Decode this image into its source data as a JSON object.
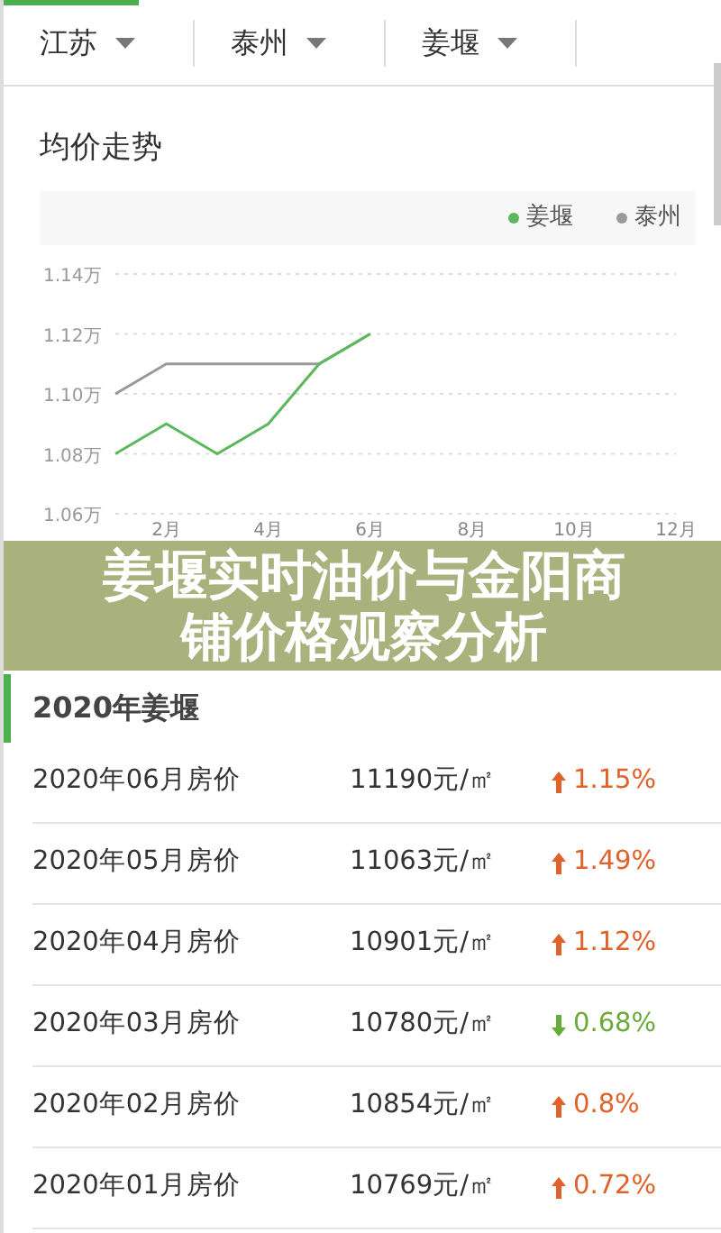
{
  "filters": [
    {
      "label": "江苏"
    },
    {
      "label": "泰州"
    },
    {
      "label": "姜堰"
    }
  ],
  "trend": {
    "title": "均价走势",
    "chart_data": {
      "type": "line",
      "x": [
        1,
        2,
        3,
        4,
        5,
        6
      ],
      "series": [
        {
          "name": "姜堰",
          "color": "#5cb85c",
          "values": [
            1.08,
            1.09,
            1.08,
            1.09,
            1.11,
            1.12
          ]
        },
        {
          "name": "泰州",
          "color": "#999999",
          "values": [
            1.1,
            1.11,
            1.11,
            1.11,
            1.11,
            1.12
          ]
        }
      ],
      "xlim": [
        1,
        12
      ],
      "ylim": [
        1.06,
        1.14
      ],
      "grid": true,
      "xticks": [
        {
          "value": 2,
          "label": "2月"
        },
        {
          "value": 4,
          "label": "4月"
        },
        {
          "value": 6,
          "label": "6月"
        },
        {
          "value": 8,
          "label": "8月"
        },
        {
          "value": 10,
          "label": "10月"
        },
        {
          "value": 12,
          "label": "12月"
        }
      ],
      "yticks": [
        {
          "value": 1.06,
          "label": "1.06万"
        },
        {
          "value": 1.08,
          "label": "1.08万"
        },
        {
          "value": 1.1,
          "label": "1.10万"
        },
        {
          "value": 1.12,
          "label": "1.12万"
        },
        {
          "value": 1.14,
          "label": "1.14万"
        }
      ]
    }
  },
  "banner": {
    "title": "姜堰实时油价与金阳商铺价格观察分析"
  },
  "prices": {
    "heading": "2020年姜堰",
    "rows": [
      {
        "month": "2020年06月房价",
        "price": "11190元/㎡",
        "kind": "up",
        "change": "1.15%"
      },
      {
        "month": "2020年05月房价",
        "price": "11063元/㎡",
        "kind": "up",
        "change": "1.49%"
      },
      {
        "month": "2020年04月房价",
        "price": "10901元/㎡",
        "kind": "up",
        "change": "1.12%"
      },
      {
        "month": "2020年03月房价",
        "price": "10780元/㎡",
        "kind": "down",
        "change": "0.68%"
      },
      {
        "month": "2020年02月房价",
        "price": "10854元/㎡",
        "kind": "up",
        "change": "0.8%"
      },
      {
        "month": "2020年01月房价",
        "price": "10769元/㎡",
        "kind": "up",
        "change": "0.72%"
      }
    ]
  }
}
